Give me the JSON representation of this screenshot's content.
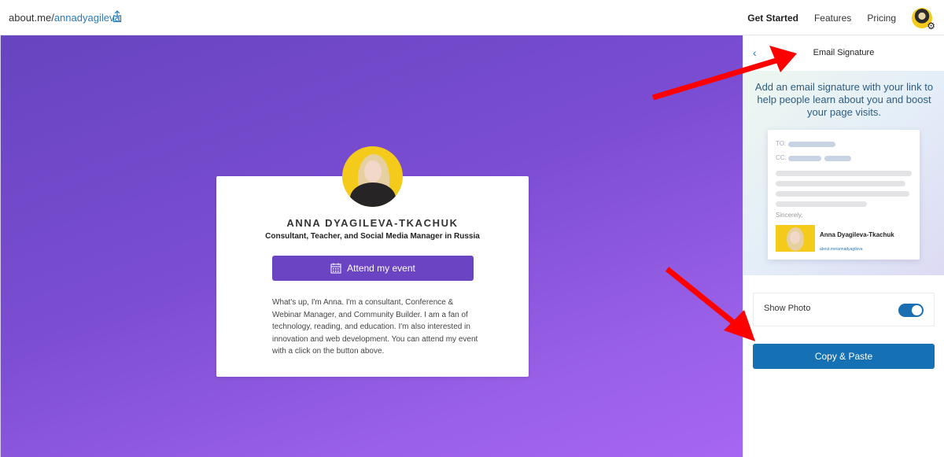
{
  "topbar": {
    "url_prefix": "about.me/",
    "url_handle": "annadyagileva",
    "nav": [
      {
        "label": "Get Started"
      },
      {
        "label": "Features"
      },
      {
        "label": "Pricing"
      }
    ]
  },
  "profile": {
    "name": "ANNA DYAGILEVA-TKACHUK",
    "headline": "Consultant, Teacher, and Social Media Manager in Russia",
    "cta_label": "Attend my event",
    "bio": "What's up, I'm Anna. I'm a consultant, Conference & Webinar Manager, and Community Builder. I am a fan of technology, reading, and education. I'm also interested in innovation and web development. You can attend my event with a click on the button above."
  },
  "panel": {
    "title": "Email Signature",
    "promo_text": "Add an email signature with your link to help people learn about you and boost your page visits.",
    "preview": {
      "to_label": "TO:",
      "cc_label": "CC:",
      "closing": "Sincerely,",
      "sig_name": "Anna Dyagileva-Tkachuk",
      "sig_link": "about.me/annadyagileva"
    },
    "show_photo_label": "Show Photo",
    "show_photo_enabled": true,
    "copy_button_label": "Copy & Paste"
  },
  "colors": {
    "brand_purple": "#6b44c4",
    "accent_blue": "#1571b3",
    "annotation_red": "#ff0000"
  }
}
